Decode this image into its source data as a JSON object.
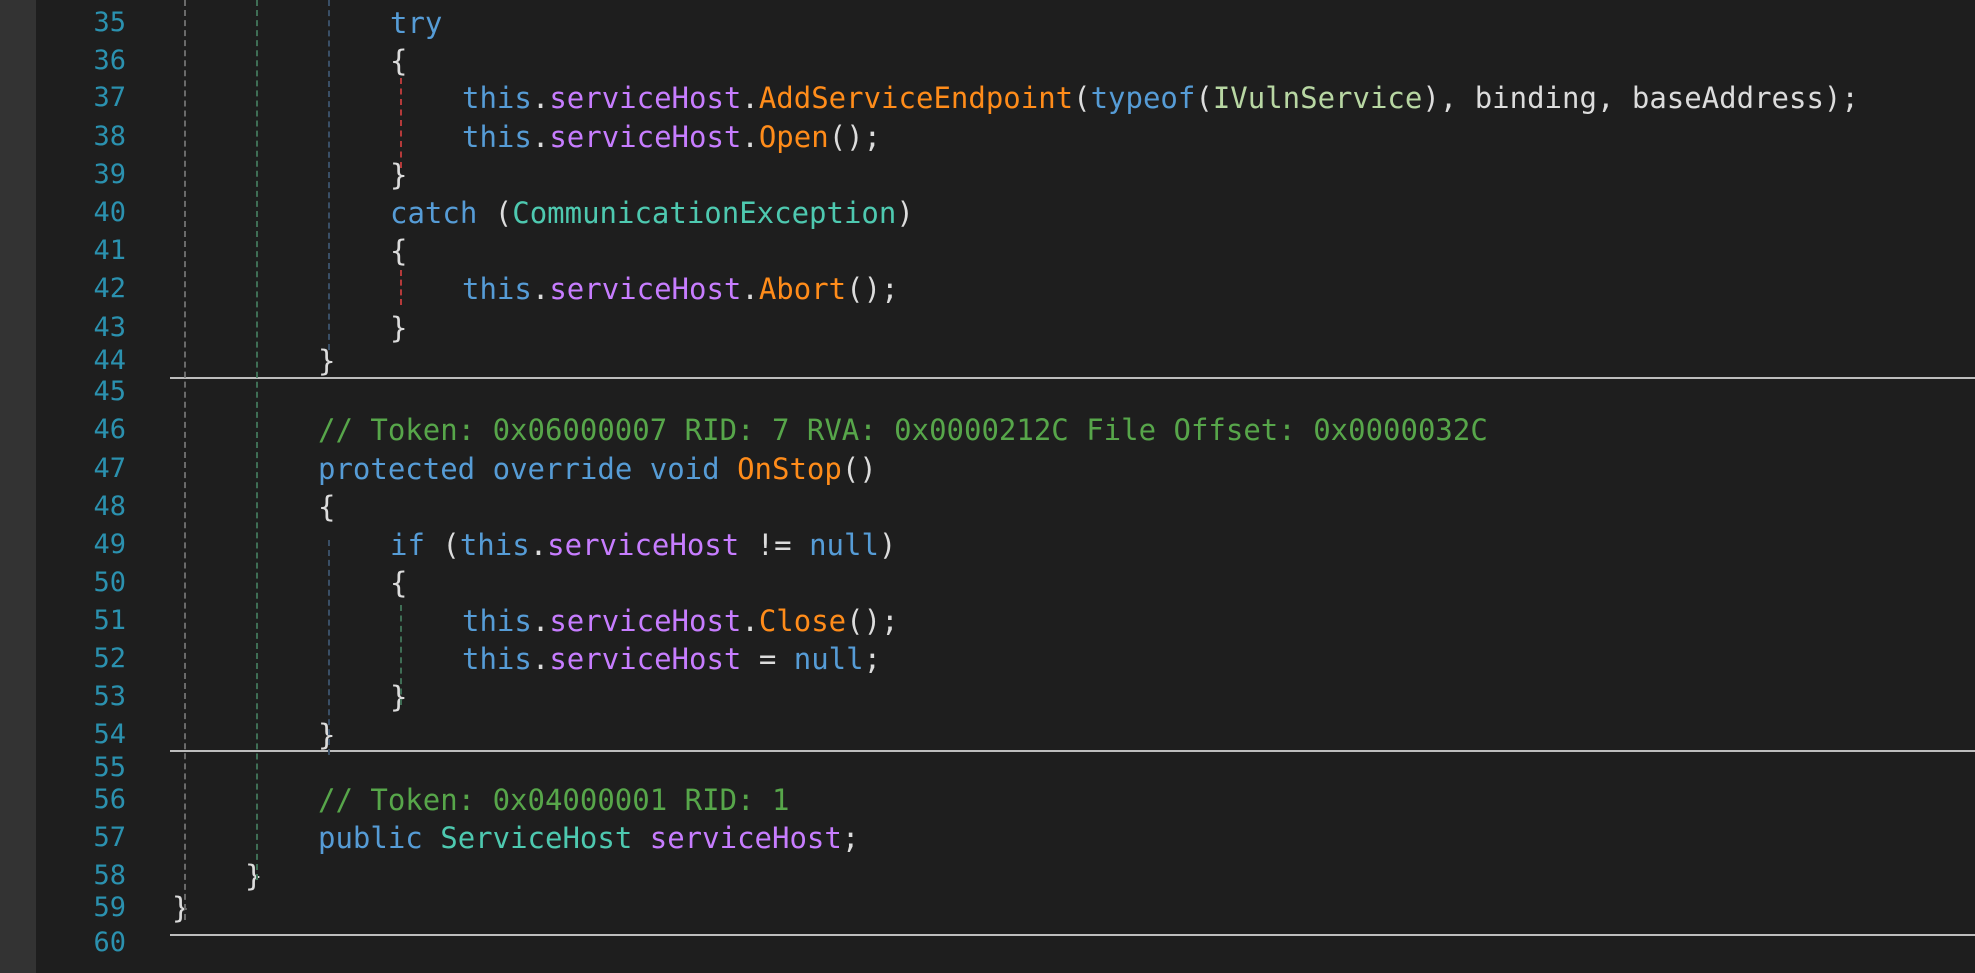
{
  "editor": {
    "colors": {
      "background": "#1e1e1e",
      "line_number": "#2b91af",
      "keyword": "#569cd6",
      "field": "#c77dff",
      "method": "#ff8c1a",
      "type": "#4ec9b0",
      "comment": "#57a64a",
      "text": "#dcdcdc"
    },
    "line_numbers": [
      "35",
      "36",
      "37",
      "38",
      "39",
      "40",
      "41",
      "42",
      "43",
      "44",
      "45",
      "46",
      "47",
      "48",
      "49",
      "50",
      "51",
      "52",
      "53",
      "54",
      "55",
      "56",
      "57",
      "58",
      "59",
      "60"
    ],
    "lines": [
      [
        {
          "c": "ctl",
          "t": "try"
        }
      ],
      [
        {
          "c": "pl",
          "t": "{"
        }
      ],
      [
        {
          "c": "kw",
          "t": "this"
        },
        {
          "c": "pl",
          "t": "."
        },
        {
          "c": "fld",
          "t": "serviceHost"
        },
        {
          "c": "pl",
          "t": "."
        },
        {
          "c": "mth",
          "t": "AddServiceEndpoint"
        },
        {
          "c": "pl",
          "t": "("
        },
        {
          "c": "kw",
          "t": "typeof"
        },
        {
          "c": "pl",
          "t": "("
        },
        {
          "c": "iface",
          "t": "IVulnService"
        },
        {
          "c": "pl",
          "t": "), binding, baseAddress);"
        }
      ],
      [
        {
          "c": "kw",
          "t": "this"
        },
        {
          "c": "pl",
          "t": "."
        },
        {
          "c": "fld",
          "t": "serviceHost"
        },
        {
          "c": "pl",
          "t": "."
        },
        {
          "c": "mth",
          "t": "Open"
        },
        {
          "c": "pl",
          "t": "();"
        }
      ],
      [
        {
          "c": "pl",
          "t": "}"
        }
      ],
      [
        {
          "c": "ctl",
          "t": "catch"
        },
        {
          "c": "pl",
          "t": " ("
        },
        {
          "c": "typ",
          "t": "CommunicationException"
        },
        {
          "c": "pl",
          "t": ")"
        }
      ],
      [
        {
          "c": "pl",
          "t": "{"
        }
      ],
      [
        {
          "c": "kw",
          "t": "this"
        },
        {
          "c": "pl",
          "t": "."
        },
        {
          "c": "fld",
          "t": "serviceHost"
        },
        {
          "c": "pl",
          "t": "."
        },
        {
          "c": "mth",
          "t": "Abort"
        },
        {
          "c": "pl",
          "t": "();"
        }
      ],
      [
        {
          "c": "pl",
          "t": "}"
        }
      ],
      [
        {
          "c": "pl",
          "t": "}"
        }
      ],
      [],
      [
        {
          "c": "cmt",
          "t": "// Token: 0x06000007 RID: 7 RVA: 0x0000212C File Offset: 0x0000032C"
        }
      ],
      [
        {
          "c": "kw",
          "t": "protected"
        },
        {
          "c": "pl",
          "t": " "
        },
        {
          "c": "kw",
          "t": "override"
        },
        {
          "c": "pl",
          "t": " "
        },
        {
          "c": "kw",
          "t": "void"
        },
        {
          "c": "pl",
          "t": " "
        },
        {
          "c": "mth",
          "t": "OnStop"
        },
        {
          "c": "pl",
          "t": "()"
        }
      ],
      [
        {
          "c": "pl",
          "t": "{"
        }
      ],
      [
        {
          "c": "ctl",
          "t": "if"
        },
        {
          "c": "pl",
          "t": " ("
        },
        {
          "c": "kw",
          "t": "this"
        },
        {
          "c": "pl",
          "t": "."
        },
        {
          "c": "fld",
          "t": "serviceHost"
        },
        {
          "c": "pl",
          "t": " != "
        },
        {
          "c": "kw",
          "t": "null"
        },
        {
          "c": "pl",
          "t": ")"
        }
      ],
      [
        {
          "c": "pl",
          "t": "{"
        }
      ],
      [
        {
          "c": "kw",
          "t": "this"
        },
        {
          "c": "pl",
          "t": "."
        },
        {
          "c": "fld",
          "t": "serviceHost"
        },
        {
          "c": "pl",
          "t": "."
        },
        {
          "c": "mth",
          "t": "Close"
        },
        {
          "c": "pl",
          "t": "();"
        }
      ],
      [
        {
          "c": "kw",
          "t": "this"
        },
        {
          "c": "pl",
          "t": "."
        },
        {
          "c": "fld",
          "t": "serviceHost"
        },
        {
          "c": "pl",
          "t": " = "
        },
        {
          "c": "kw",
          "t": "null"
        },
        {
          "c": "pl",
          "t": ";"
        }
      ],
      [
        {
          "c": "pl",
          "t": "}"
        }
      ],
      [
        {
          "c": "pl",
          "t": "}"
        }
      ],
      [],
      [
        {
          "c": "cmt",
          "t": "// Token: 0x04000001 RID: 1"
        }
      ],
      [
        {
          "c": "kw",
          "t": "public"
        },
        {
          "c": "pl",
          "t": " "
        },
        {
          "c": "typ",
          "t": "ServiceHost"
        },
        {
          "c": "pl",
          "t": " "
        },
        {
          "c": "fld",
          "t": "serviceHost"
        },
        {
          "c": "pl",
          "t": ";"
        }
      ],
      [
        {
          "c": "pl",
          "t": "}"
        }
      ],
      [
        {
          "c": "pl",
          "t": "}"
        }
      ],
      []
    ]
  }
}
